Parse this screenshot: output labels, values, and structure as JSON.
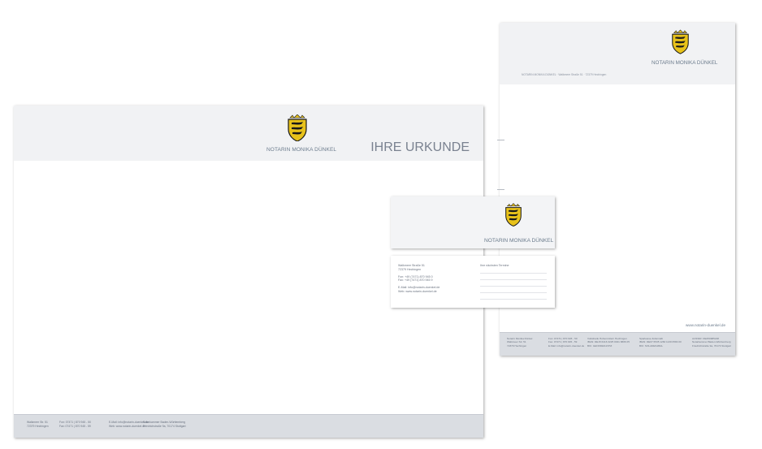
{
  "folder": {
    "brand": "NOTARIN MONIKA DÜNKEL",
    "headline": "IHRE URKUNDE",
    "footer": {
      "col1": [
        "Walkmeer Str. 51",
        "72379 Hechingen"
      ],
      "col2": [
        "Fon:  07471 | 870 945 - 50",
        "Fax:  07471 | 870 945 - 59"
      ],
      "col3": [
        "E-Mail:  info@notarin-duenkel.de",
        "Web:   www.notarin-duenkel.de"
      ],
      "col4": [
        "Notarkammer Baden-Württemberg",
        "Friedrichstraße 9a, 70174 Stuttgart"
      ]
    }
  },
  "letter": {
    "brand": "NOTARIN MONIKA DÜNKEL",
    "address_line": "NOTARIN MONIKA DÜNKEL   ·   Walkmeer Straße 51   ·   72379 Hechingen",
    "web": "www.notarin-duenkel.de",
    "footer": {
      "col1": [
        "Notarin Monika Dünkel",
        "Walkmeer Str. 51",
        "72379 Hechingen"
      ],
      "col2": [
        "Fon:  07471 | 870 945 - 50",
        "Fax:  07471 | 870 945 - 59",
        "E-Mail:  info@notarin-duenkel.de"
      ],
      "col3": [
        "Volksbank Hohenzollern Hechingen",
        "IBAN: DE15 6416 3225 0021 8806 05",
        "BIC:  GENODES1VHZ"
      ],
      "col4": [
        "Sparkasse Zollernalb",
        "IBAN:  DE07 6535 1260 1130 0584 00",
        "BIC:   SOLADES1BAL"
      ],
      "col5": [
        "AUSSIR:  DE250985228",
        "Notarkammer Baden-Württemberg",
        "Friedrichstraße 9a, 70174 Stuttgart"
      ]
    }
  },
  "card_front": {
    "brand": "NOTARIN MONIKA DÜNKEL"
  },
  "card_back": {
    "street": "Walkmeer Straße 51",
    "city": "72379 Hechingen",
    "fon": "Fon:     +49 (7471) 870 945 0",
    "fax": "Fax:     +49 (7471) 870 945 9",
    "email": "E-Mail:   info@notarin-duenkel.de",
    "web": "Web:     www.notarin-duenkel.de",
    "appointment_label": "Ihre nächsten Termine"
  },
  "colors": {
    "crest_gold": "#e8c21a",
    "crest_black": "#1a1a1a",
    "brand_text": "#6b7b8c",
    "footer_band": "#dadde2",
    "header_band": "#f1f2f4"
  },
  "icons": {
    "crest": "coat-of-arms-icon"
  }
}
